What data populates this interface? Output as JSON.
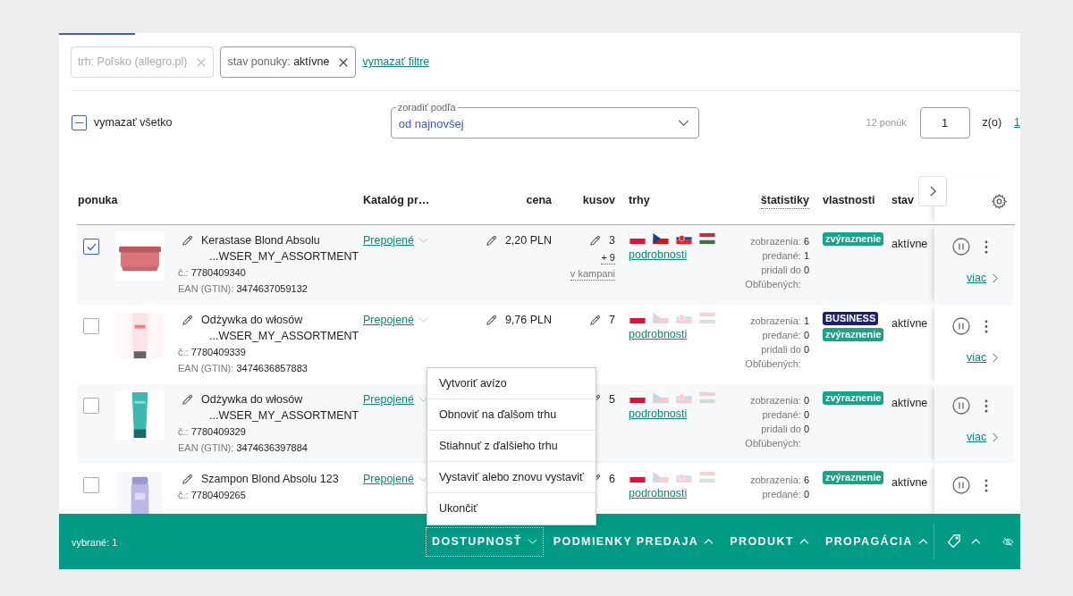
{
  "filters": [
    {
      "label": "trh:",
      "value": "Poľsko (allegro.pl)",
      "disabled": true
    },
    {
      "label": "stav ponuky:",
      "value": "aktívne",
      "disabled": false
    }
  ],
  "clear_filters": "vymazať filtre",
  "select_all": {
    "label": "vymazať všetko",
    "indeterminate": true
  },
  "sort": {
    "label": "zoradiť podľa",
    "value": "od najnovšej"
  },
  "pagination": {
    "count": "12 ponúk",
    "page": "1",
    "of": "z(o)",
    "total": "1"
  },
  "columns": [
    {
      "label": "ponuka",
      "underlined": false
    },
    {
      "label": "Katalóg pr…",
      "underlined": false
    },
    {
      "label": "cena",
      "underlined": false
    },
    {
      "label": "kusov",
      "underlined": false
    },
    {
      "label": "trhy",
      "underlined": false
    },
    {
      "label": "štatistiky",
      "underlined": true
    },
    {
      "label": "vlastnosti",
      "underlined": false
    },
    {
      "label": "stav",
      "underlined": false
    }
  ],
  "rows": [
    {
      "checked": true,
      "name": "Kerastase Blond Absolu",
      "name_suffix": "...WSER_MY_ASSORTMENT",
      "number_label": "č.:",
      "number": "7780409340",
      "ean_label": "EAN (GTIN):",
      "ean": "3474637059132",
      "catalog": "Prepojené",
      "price": "2,20 PLN",
      "quantity": "3",
      "campaign_qty": "+ 9",
      "campaign_label": "v kampani",
      "markets": [
        {
          "kind": "pl",
          "active": true
        },
        {
          "kind": "cz",
          "active": true
        },
        {
          "kind": "sk",
          "active": true
        },
        {
          "kind": "hu",
          "active": true
        }
      ],
      "details": "podrobnosti",
      "stats": [
        {
          "label": "zobrazenia:",
          "value": "6"
        },
        {
          "label": "predané:",
          "value": "1"
        },
        {
          "label": "pridali do Obľúbených:",
          "value": "0"
        }
      ],
      "badges": [
        {
          "kind": "highlight",
          "text": "zvýraznenie"
        }
      ],
      "status": "aktívne",
      "more": "viac"
    },
    {
      "checked": false,
      "name": "Odżywka do włosów",
      "name_suffix": "...WSER_MY_ASSORTMENT",
      "number_label": "č.:",
      "number": "7780409339",
      "ean_label": "EAN (GTIN):",
      "ean": "3474636857883",
      "catalog": "Prepojené",
      "price": "9,76 PLN",
      "quantity": "7",
      "markets": [
        {
          "kind": "pl",
          "active": true
        },
        {
          "kind": "cz",
          "active": false
        },
        {
          "kind": "sk",
          "active": false
        },
        {
          "kind": "hu",
          "active": false
        }
      ],
      "details": "podrobnosti",
      "stats": [
        {
          "label": "zobrazenia:",
          "value": "1"
        },
        {
          "label": "predané:",
          "value": "0"
        },
        {
          "label": "pridali do Obľúbených:",
          "value": "0"
        }
      ],
      "badges": [
        {
          "kind": "business",
          "text": "BUSINESS"
        },
        {
          "kind": "highlight",
          "text": "zvýraznenie"
        }
      ],
      "status": "aktívne",
      "more": "viac"
    },
    {
      "checked": false,
      "name": "Odżywka do włosów",
      "name_suffix": "...WSER_MY_ASSORTMENT",
      "number_label": "č.:",
      "number": "7780409329",
      "ean_label": "EAN (GTIN):",
      "ean": "3474636397884",
      "catalog": "Prepojené",
      "quantity": "5",
      "markets": [
        {
          "kind": "pl",
          "active": true
        },
        {
          "kind": "cz",
          "active": false
        },
        {
          "kind": "sk",
          "active": false
        },
        {
          "kind": "hu",
          "active": false
        }
      ],
      "details": "podrobnosti",
      "stats": [
        {
          "label": "zobrazenia:",
          "value": "0"
        },
        {
          "label": "predané:",
          "value": "0"
        },
        {
          "label": "pridali do Obľúbených:",
          "value": "0"
        }
      ],
      "badges": [
        {
          "kind": "highlight",
          "text": "zvýraznenie"
        }
      ],
      "status": "aktívne",
      "more": "viac"
    },
    {
      "checked": false,
      "name": "Szampon Blond Absolu 123",
      "number_label": "č.:",
      "number": "7780409265",
      "catalog": "Prepojené",
      "quantity": "6",
      "markets": [
        {
          "kind": "pl",
          "active": true
        },
        {
          "kind": "cz",
          "active": false
        },
        {
          "kind": "sk",
          "active": false
        },
        {
          "kind": "hu",
          "active": false
        }
      ],
      "details": "podrobnosti",
      "stats": [
        {
          "label": "zobrazenia:",
          "value": "6"
        },
        {
          "label": "predané:",
          "value": "0"
        }
      ],
      "badges": [
        {
          "kind": "highlight",
          "text": "zvýraznenie"
        }
      ],
      "status": "aktívne"
    }
  ],
  "menu": {
    "items": [
      "Vytvoriť avízo",
      "Obnoviť na ďalšom trhu",
      "Stiahnuť z ďalšieho trhu",
      "Vystaviť alebo znovu vystaviť",
      "Ukončiť"
    ]
  },
  "action_bar": {
    "selected": "vybrané: 1",
    "groups": [
      {
        "label": "DOSTUPNOSŤ",
        "expanded": true
      },
      {
        "label": "PODMIENKY PREDAJA",
        "expanded": false
      },
      {
        "label": "PRODUKT",
        "expanded": false
      },
      {
        "label": "PROPAGÁCIA",
        "expanded": false
      }
    ]
  }
}
